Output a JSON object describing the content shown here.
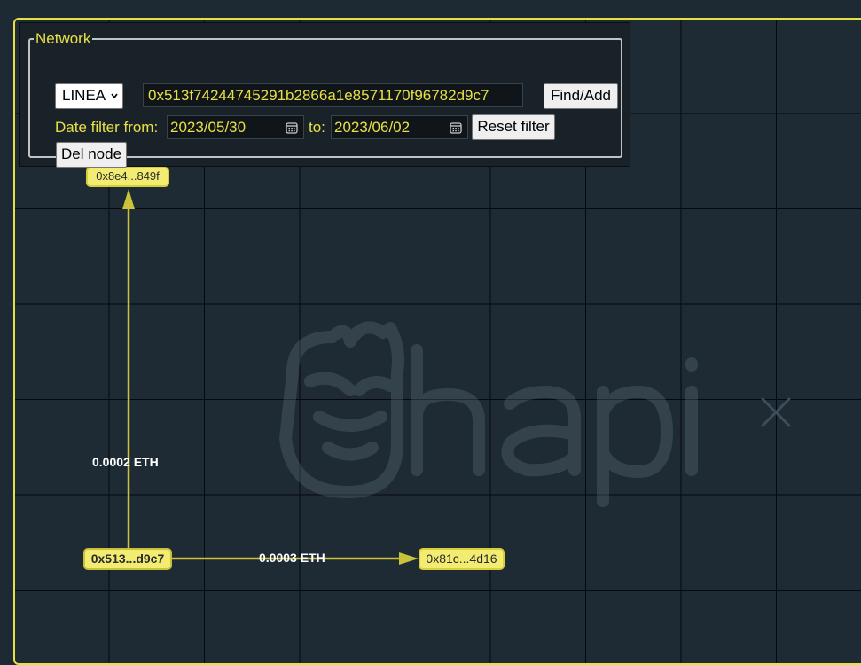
{
  "network_panel": {
    "legend": "Network",
    "network_select": {
      "selected": "LINEA"
    },
    "address_input": {
      "value": "0x513f74244745291b2866a1e8571170f96782d9c7"
    },
    "find_add_label": "Find/Add",
    "date_filter_from_label": "Date filter from:",
    "date_from": "2023/05/30",
    "to_label": "to:",
    "date_to": "2023/06/02",
    "reset_filter_label": "Reset filter",
    "del_node_label": "Del node"
  },
  "graph": {
    "nodes": [
      {
        "id": "n0",
        "label": "0x513...d9c7",
        "selected": true
      },
      {
        "id": "n1",
        "label": "0x8e4...849f"
      },
      {
        "id": "n2",
        "label": "0x81c...4d16"
      }
    ],
    "edges": [
      {
        "from": "n0",
        "to": "n1",
        "label": "0.0002 ETH"
      },
      {
        "from": "n0",
        "to": "n2",
        "label": "0.0003 ETH"
      }
    ],
    "accent_color": "#e7e045",
    "edge_color": "#c9c23a"
  },
  "watermark": {
    "text": "hapi"
  }
}
